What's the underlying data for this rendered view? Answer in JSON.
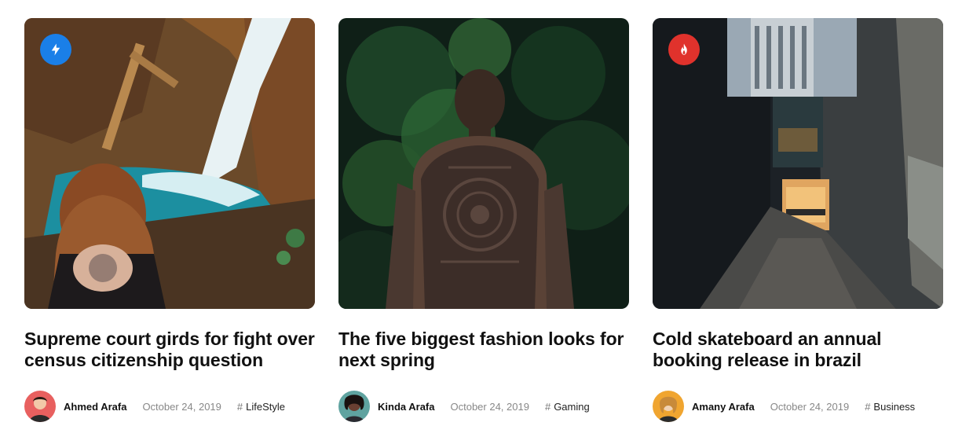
{
  "posts": [
    {
      "title": "Supreme court girds for fight over census citizenship question",
      "author": "Ahmed Arafa",
      "date": "October 24, 2019",
      "tag": "LifeStyle",
      "tag_prefix": "#",
      "badge_icon": "lightning-icon",
      "badge_color": "#1a7fe8",
      "image": "woman with back tattoo sitting by a waterfall"
    },
    {
      "title": "The five biggest fashion looks for next spring",
      "author": "Kinda Arafa",
      "date": "October 24, 2019",
      "tag": "Gaming",
      "tag_prefix": "#",
      "badge_icon": null,
      "image": "man with full back tattoo in a forest"
    },
    {
      "title": "Cold skateboard an annual booking release in brazil",
      "author": "Amany Arafa",
      "date": "October 24, 2019",
      "tag": "Business",
      "tag_prefix": "#",
      "badge_icon": "flame-icon",
      "badge_color": "#e0322c",
      "image": "narrow alley between dark buildings with lit doorway"
    }
  ]
}
